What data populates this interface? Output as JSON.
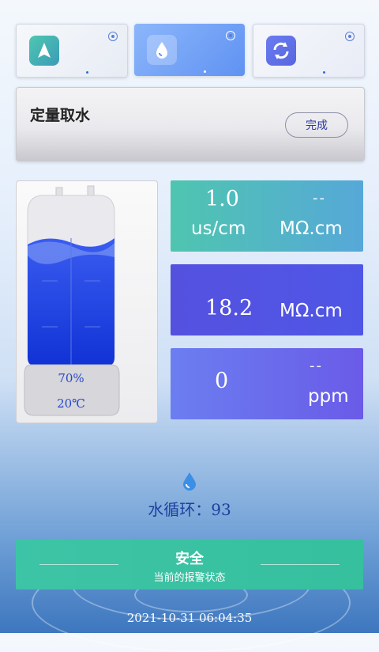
{
  "modes": [
    {
      "name": "location-arrow-icon",
      "active": false
    },
    {
      "name": "water-drop-icon",
      "active": true
    },
    {
      "name": "refresh-icon",
      "active": false
    }
  ],
  "panel": {
    "title": "定量取水",
    "done_label": "完成"
  },
  "tank": {
    "level": "70%",
    "temp": "20℃"
  },
  "metrics": [
    {
      "value": "1.0",
      "unit": "us/cm",
      "alt_value": "--",
      "alt_unit": "MΩ.cm"
    },
    {
      "value": "18.2",
      "unit": "MΩ.cm"
    },
    {
      "value": "0",
      "alt_value": "--",
      "unit": "ppm"
    }
  ],
  "circulation": {
    "label": "水循环：93"
  },
  "alarm": {
    "title": "安全",
    "subtitle": "当前的报警状态"
  },
  "timestamp": "2021-10-31 06:04:35",
  "colors": {
    "accent_blue": "#5a8ef5",
    "metric1": "#4fbdb1",
    "metric2": "#5452e2",
    "metric3": "#6a5ce8",
    "safe_green": "#3dc4a6"
  }
}
